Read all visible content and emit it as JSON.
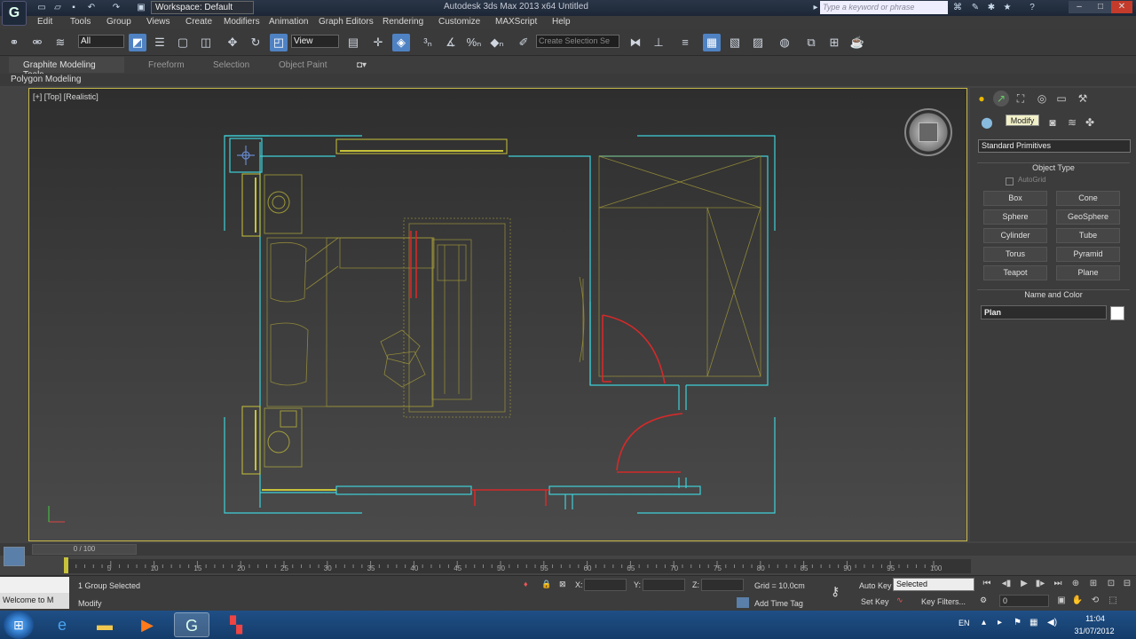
{
  "titlebar": {
    "window_title": "Autodesk 3ds Max 2013 x64      Untitled",
    "workspace": "Workspace: Default",
    "search_placeholder": "Type a keyword or phrase"
  },
  "menu": [
    "Edit",
    "Tools",
    "Group",
    "Views",
    "Create",
    "Modifiers",
    "Animation",
    "Graph Editors",
    "Rendering",
    "Customize",
    "MAXScript",
    "Help"
  ],
  "toolbar": {
    "selection_filter": "All",
    "reference_coord": "View",
    "named_selection_placeholder": "Create Selection Se"
  },
  "ribbon": {
    "tabs": [
      "Graphite Modeling Tools",
      "Freeform",
      "Selection",
      "Object Paint"
    ],
    "subtab": "Polygon Modeling"
  },
  "viewport": {
    "label": "[+] [Top] [Realistic]"
  },
  "command_panel": {
    "tooltip": "Modify",
    "category": "Standard Primitives",
    "object_type_title": "Object Type",
    "autogrid_label": "AutoGrid",
    "primitives": [
      "Box",
      "Cone",
      "Sphere",
      "GeoSphere",
      "Cylinder",
      "Tube",
      "Torus",
      "Pyramid",
      "Teapot",
      "Plane"
    ],
    "name_color_title": "Name and Color",
    "object_name": "Plan"
  },
  "timeline": {
    "frame_counter": "0 / 100",
    "ticks": [
      "5",
      "10",
      "15",
      "20",
      "25",
      "30",
      "35",
      "40",
      "45",
      "50",
      "55",
      "60",
      "65",
      "70",
      "75",
      "80",
      "85",
      "90",
      "95",
      "100"
    ]
  },
  "status": {
    "maxscript_text": "Welcome to M",
    "selection_info": "1 Group Selected",
    "prompt": "Modify",
    "x_label": "X:",
    "y_label": "Y:",
    "z_label": "Z:",
    "grid": "Grid = 10.0cm",
    "add_time_tag": "Add Time Tag",
    "auto_key": "Auto Key",
    "set_key": "Set Key",
    "key_mode": "Selected",
    "key_filters": "Key Filters...",
    "frame": "0"
  },
  "taskbar": {
    "lang": "EN",
    "time": "11:04",
    "date": "31/07/2012"
  },
  "colors": {
    "wall_cyan": "#3fd0d8",
    "furniture_yellow": "#c8c23a",
    "door_red": "#d42a2a",
    "viewport_border": "#c8b94a"
  }
}
